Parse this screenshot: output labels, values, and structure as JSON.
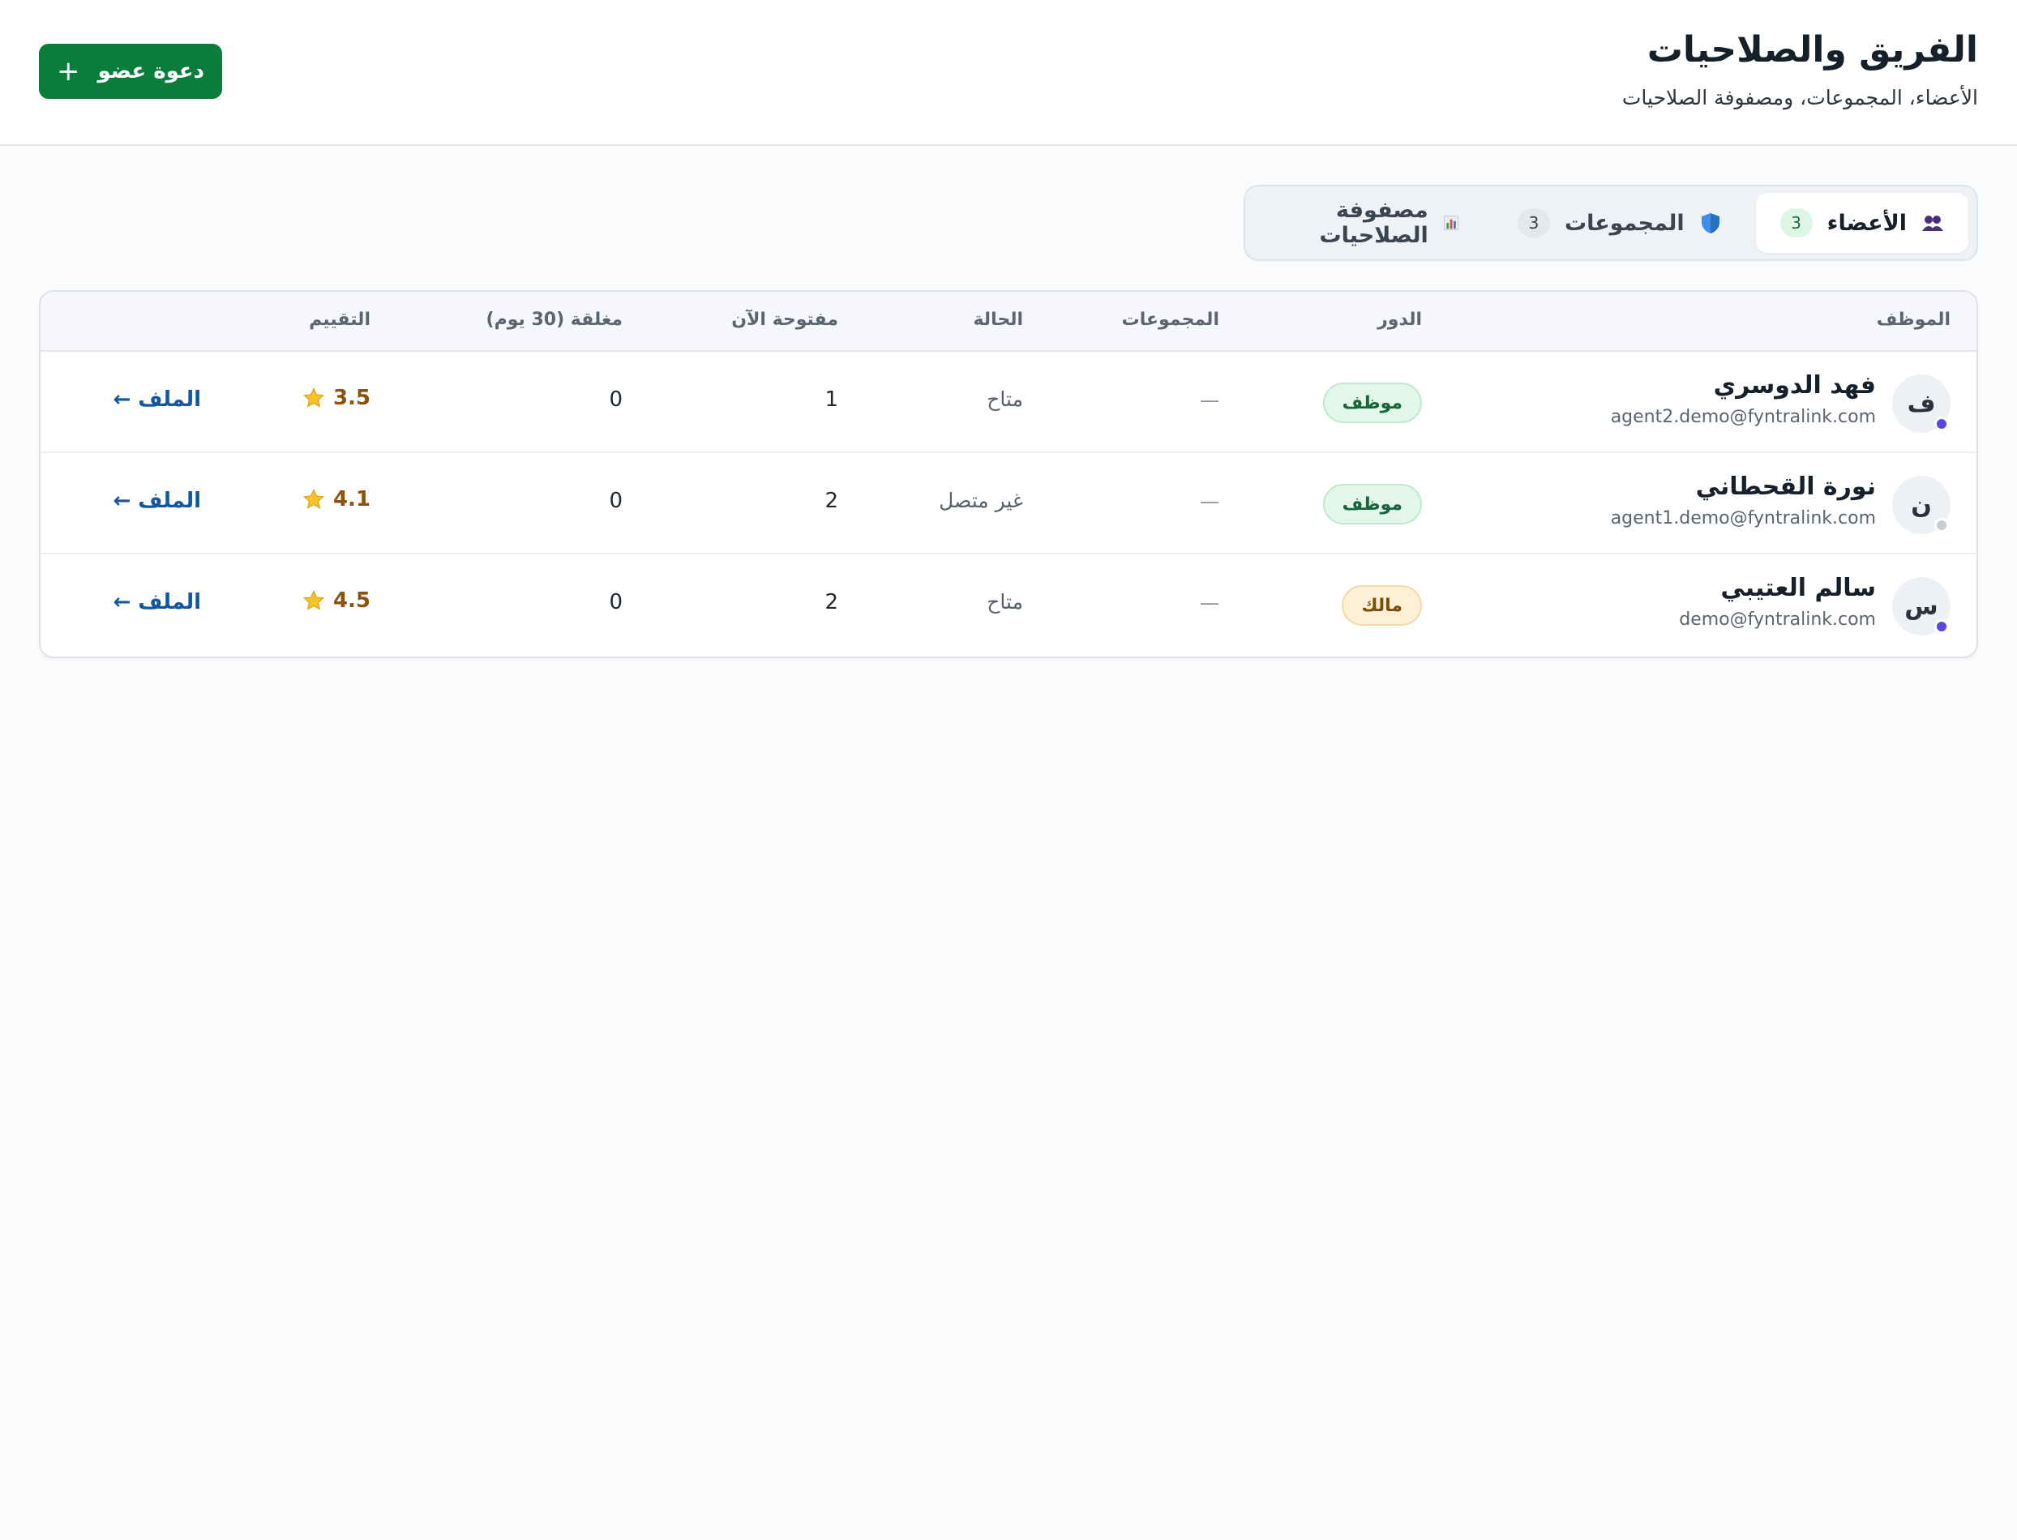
{
  "header": {
    "title": "الفريق والصلاحيات",
    "subtitle": "الأعضاء، المجموعات، ومصفوفة الصلاحيات",
    "invite_label": "دعوة عضو"
  },
  "tabs": [
    {
      "label": "الأعضاء",
      "count": "3",
      "icon": "people-icon",
      "active": true
    },
    {
      "label": "المجموعات",
      "count": "3",
      "icon": "shield-icon",
      "active": false
    },
    {
      "label": "مصفوفة الصلاحيات",
      "count": "",
      "icon": "bar-chart-icon",
      "active": false
    }
  ],
  "table": {
    "headers": {
      "employee": "الموظف",
      "role": "الدور",
      "groups": "المجموعات",
      "status": "الحالة",
      "open_now": "مفتوحة الآن",
      "closed_30d": "مغلقة (30 يوم)",
      "rating": "التقييم"
    },
    "rows": [
      {
        "initial": "ف",
        "name": "فهد الدوسري",
        "email": "agent2.demo@fyntralink.com",
        "presence_color": "#5b45e0",
        "role": "موظف",
        "role_kind": "staff",
        "groups": "—",
        "status": "متاح",
        "open_now": "1",
        "closed_30d": "0",
        "rating": "3.5",
        "profile_link": "الملف ←"
      },
      {
        "initial": "ن",
        "name": "نورة القحطاني",
        "email": "agent1.demo@fyntralink.com",
        "presence_color": "#c9ced4",
        "role": "موظف",
        "role_kind": "staff",
        "groups": "—",
        "status": "غير متصل",
        "open_now": "2",
        "closed_30d": "0",
        "rating": "4.1",
        "profile_link": "الملف ←"
      },
      {
        "initial": "س",
        "name": "سالم العتيبي",
        "email": "demo@fyntralink.com",
        "presence_color": "#5b45e0",
        "role": "مالك",
        "role_kind": "owner",
        "groups": "—",
        "status": "متاح",
        "open_now": "2",
        "closed_30d": "0",
        "rating": "4.5",
        "profile_link": "الملف ←"
      }
    ]
  },
  "colors": {
    "primary": "#0a7d3d",
    "link": "#13589e",
    "staff_badge": "#e2f6ea",
    "owner_badge": "#fdf0d6"
  }
}
